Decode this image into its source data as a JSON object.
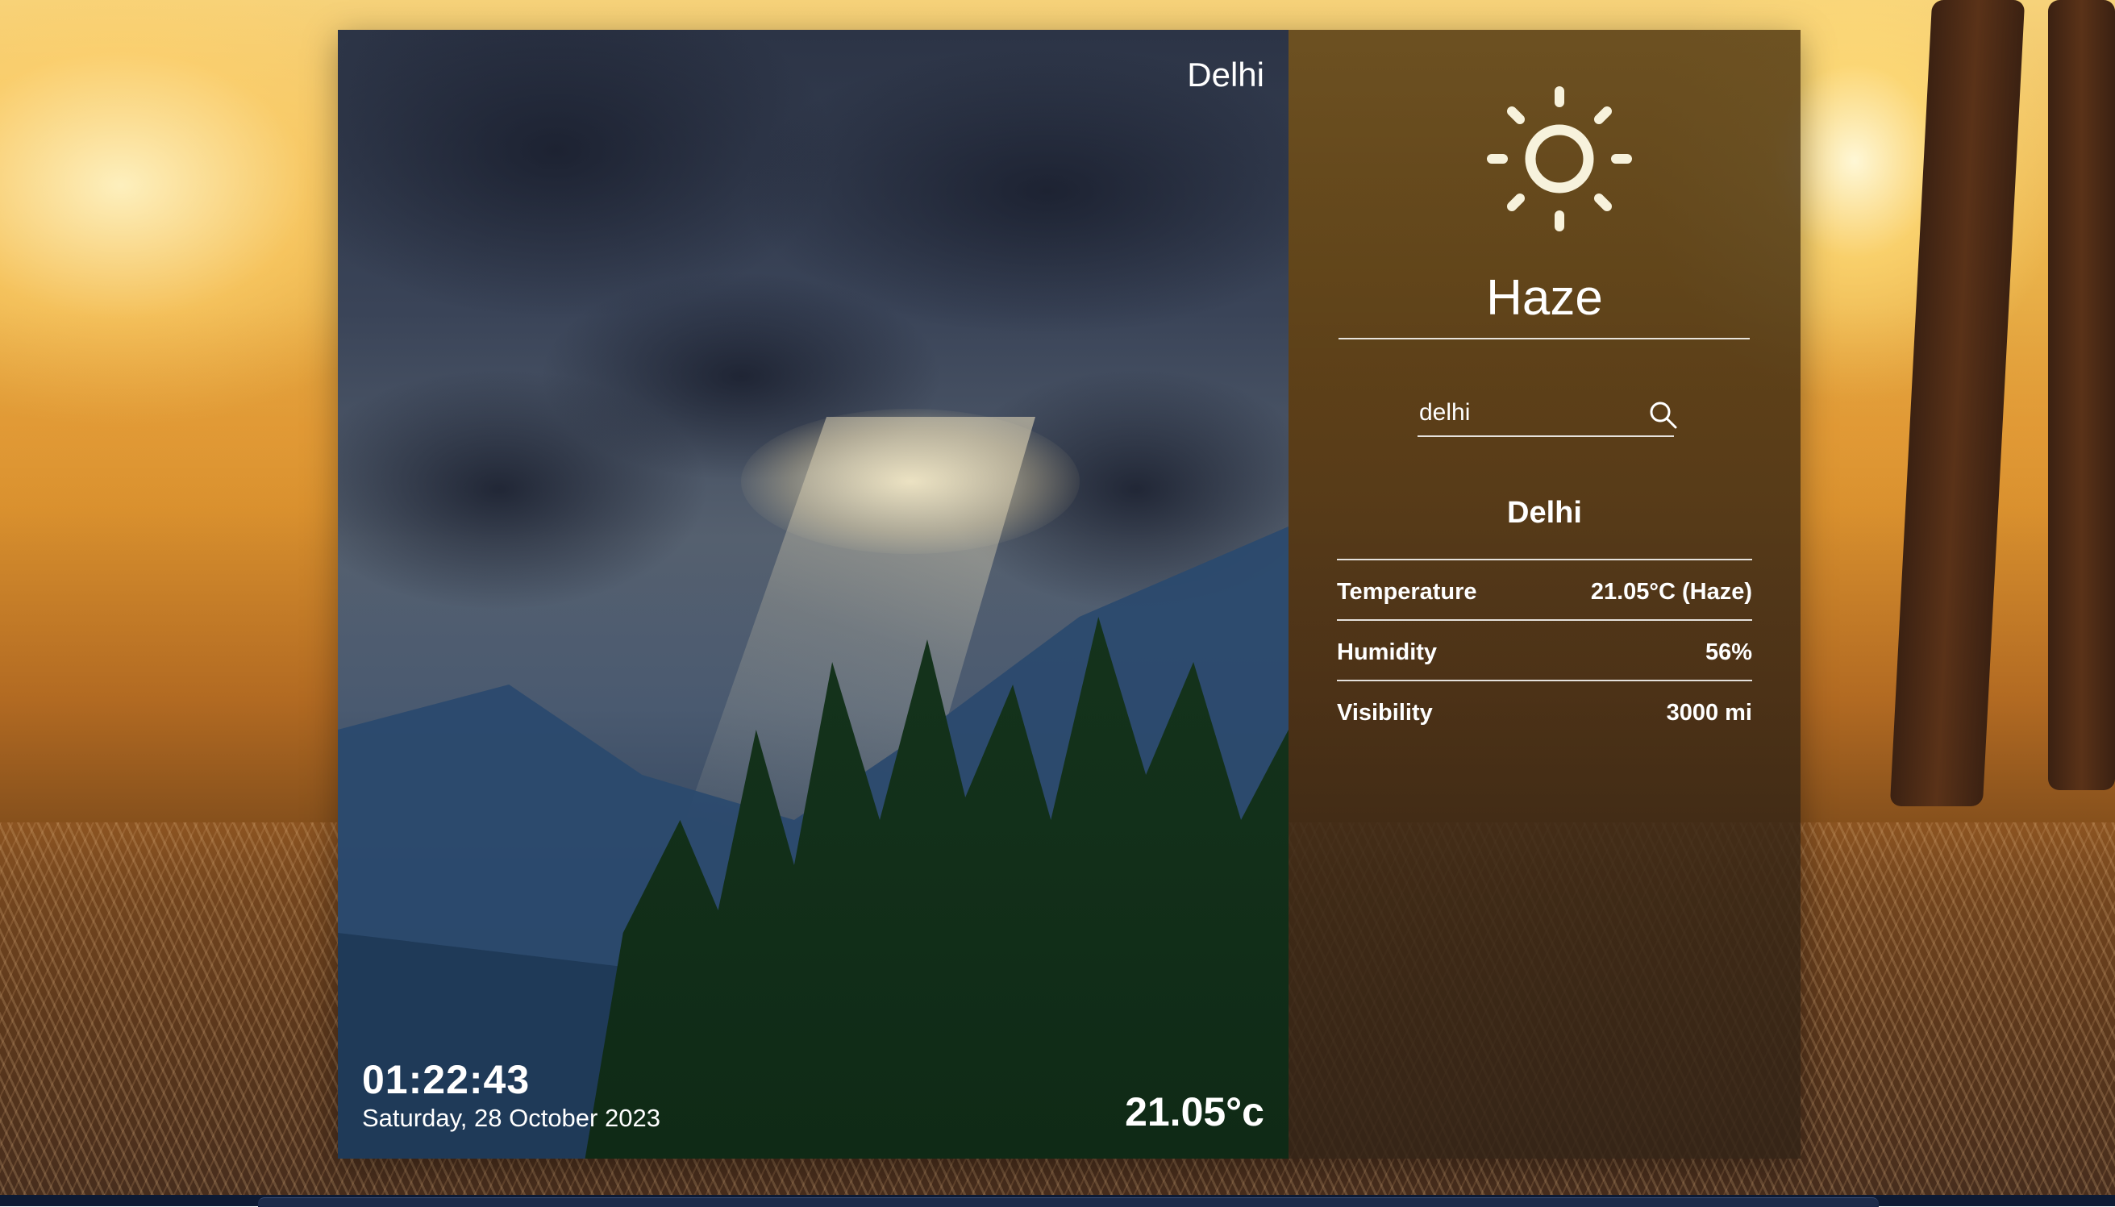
{
  "left_panel": {
    "city": "Delhi",
    "time": "01:22:43",
    "date": "Saturday, 28 October 2023",
    "temperature": "21.05°c"
  },
  "right_panel": {
    "weather_icon": "sun-icon",
    "condition": "Haze",
    "search": {
      "value": "delhi",
      "placeholder": "",
      "icon": "search-icon"
    },
    "city": "Delhi",
    "details": [
      {
        "label": "Temperature",
        "value": "21.05°C (Haze)"
      },
      {
        "label": "Humidity",
        "value": "56%"
      },
      {
        "label": "Visibility",
        "value": "3000 mi"
      }
    ]
  },
  "colors": {
    "text": "#ffffff",
    "panel_tint": "#46300a",
    "background_accent": "#eab24a"
  }
}
